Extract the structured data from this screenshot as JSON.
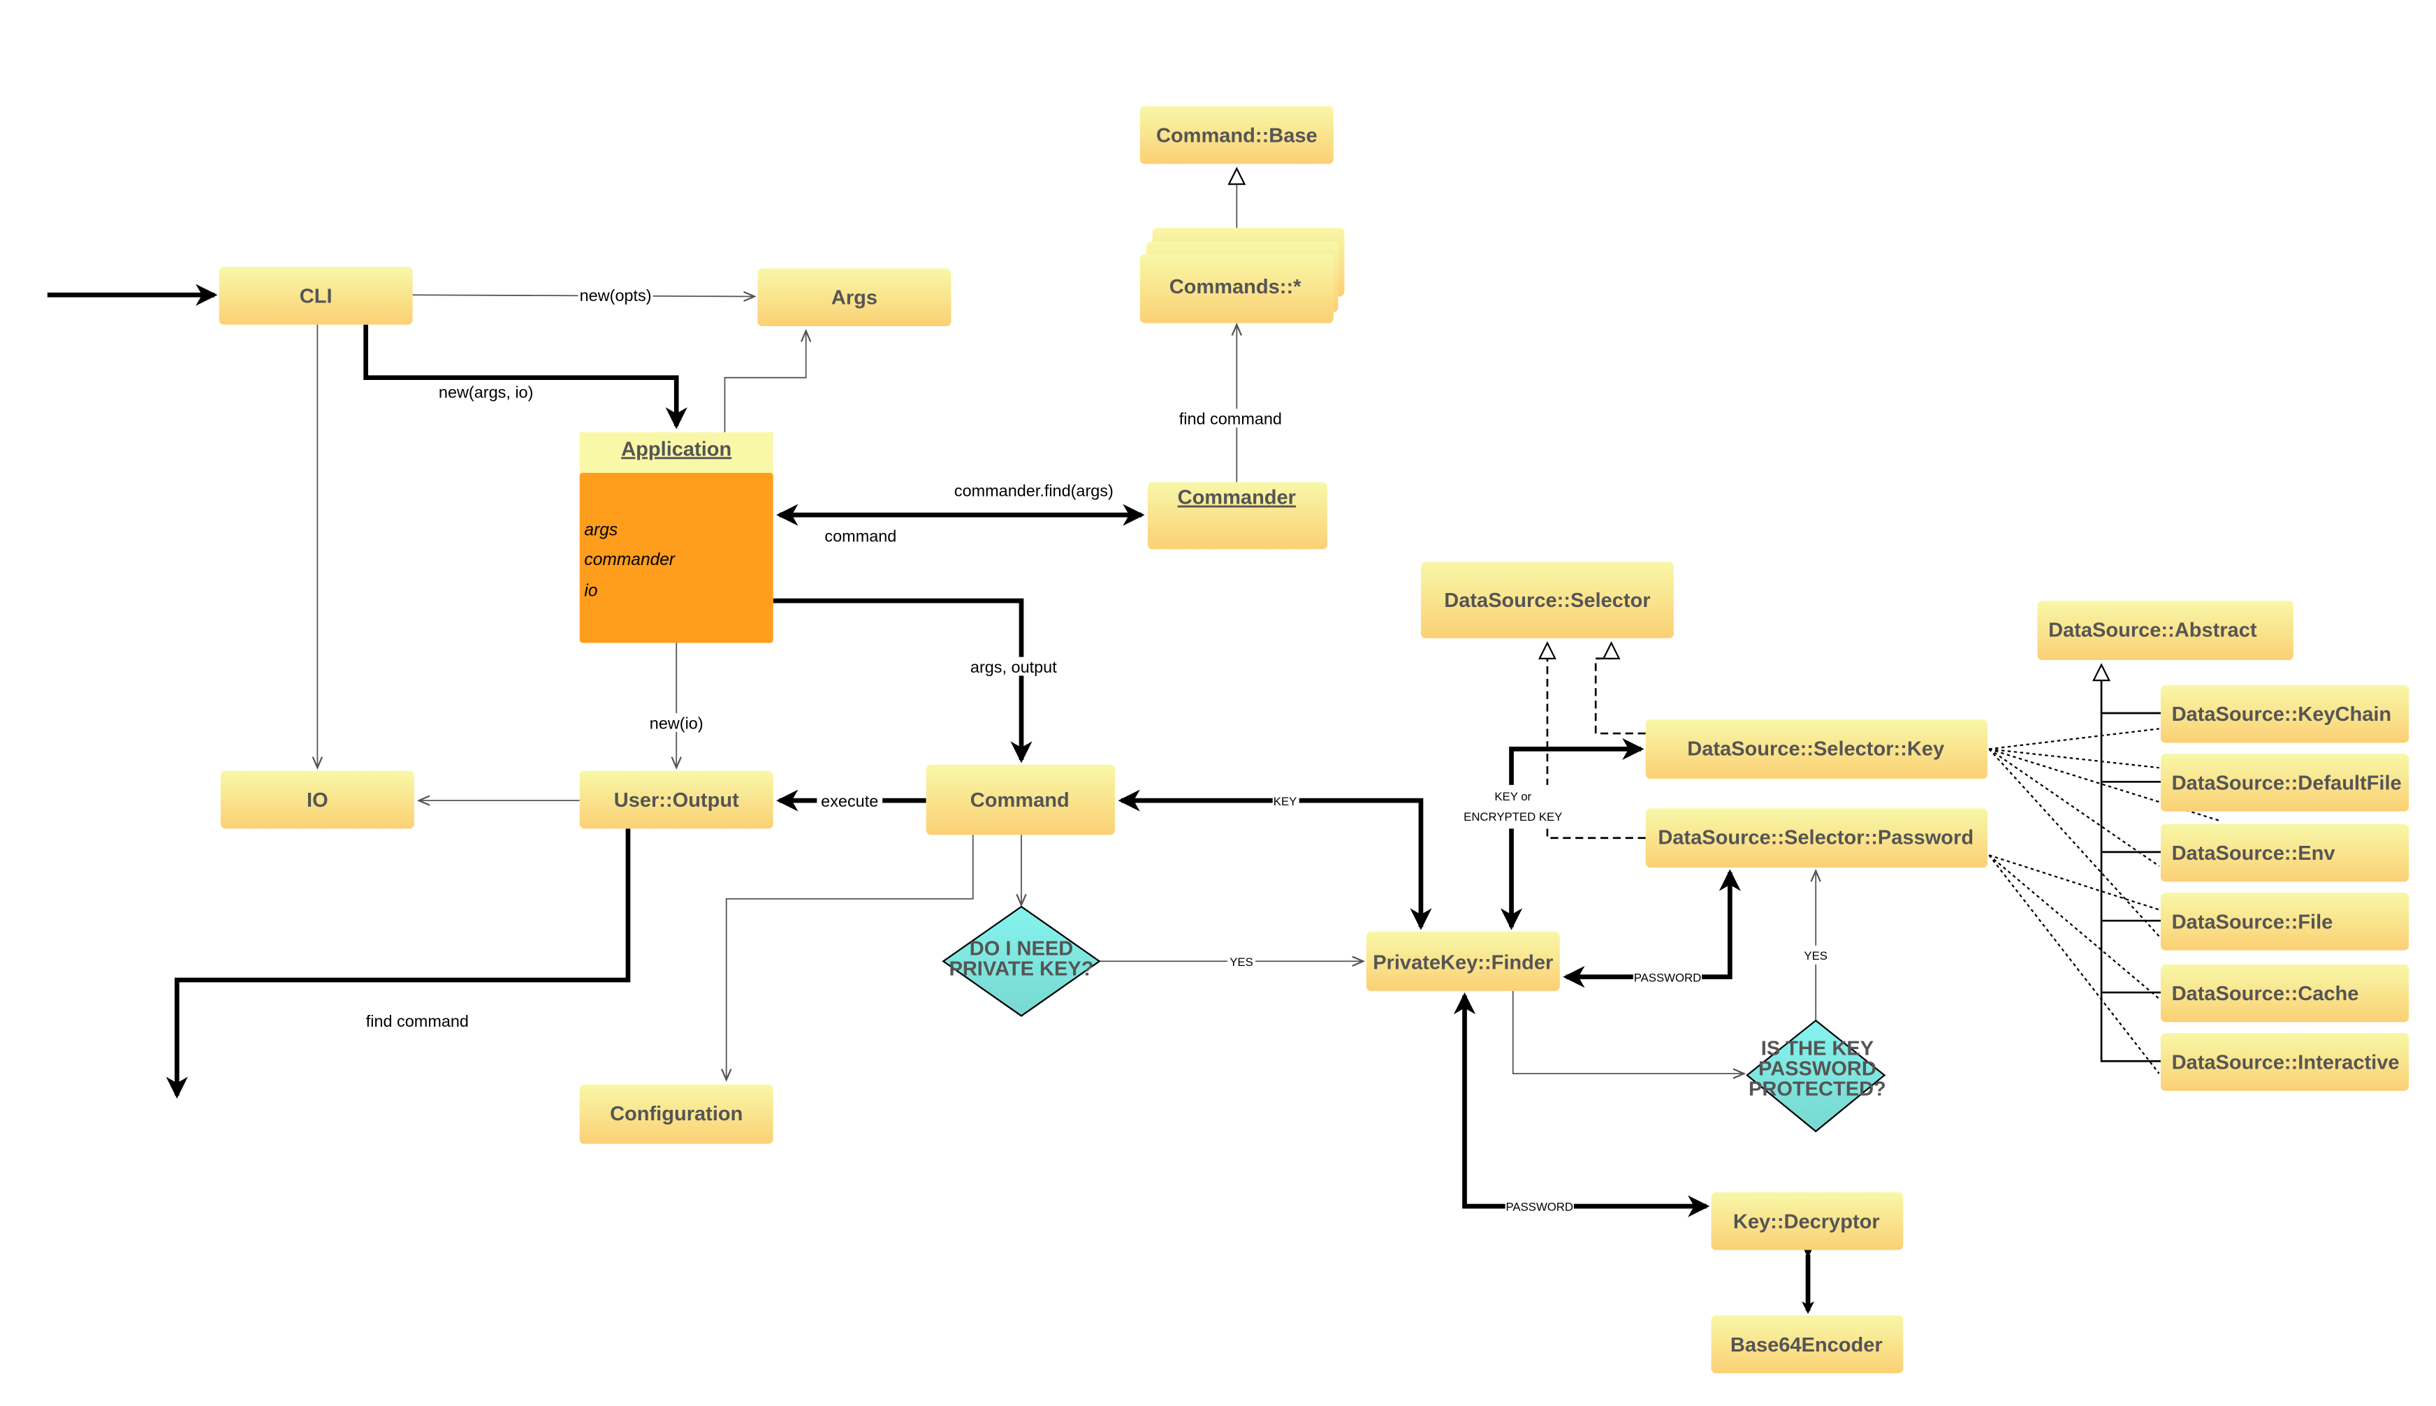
{
  "colors": {
    "box_top": "#f8f8a8",
    "box_bottom": "#fbd074",
    "application_body": "#ff9d1d",
    "diamond": "#7de8e0",
    "line": "#000000"
  },
  "nodes": {
    "cli": "CLI",
    "args": "Args",
    "command_base": "Command::Base",
    "commands": "Commands::*",
    "application": "Application",
    "application_fields": [
      "args",
      "commander",
      "io"
    ],
    "commander": "Commander",
    "io": "IO",
    "user_output": "User::Output",
    "command": "Command",
    "configuration": "Configuration",
    "do_i_need": [
      "DO I NEED",
      "PRIVATE KEY?"
    ],
    "privatekey_finder": "PrivateKey::Finder",
    "is_key_protected": [
      "IS THE KEY",
      "PASSWORD",
      "PROTECTED?"
    ],
    "ds_selector": "DataSource::Selector",
    "ds_selector_key": "DataSource::Selector::Key",
    "ds_selector_password": "DataSource::Selector::Password",
    "ds_abstract": "DataSource::Abstract",
    "ds_impls": [
      "DataSource::KeyChain",
      "DataSource::DefaultFile",
      "DataSource::Env",
      "DataSource::File",
      "DataSource::Cache",
      "DataSource::Interactive"
    ],
    "key_decryptor": "Key::Decryptor",
    "base64": "Base64Encoder"
  },
  "edges": {
    "new_opts": "new(opts)",
    "new_args_io": "new(args, io)",
    "commander_find": "commander.find(args)",
    "command": "command",
    "find_command_top": "find command",
    "args_output": "args, output",
    "new_io": "new(io)",
    "execute": "execute",
    "find_command_bottom": "find command",
    "yes1": "YES",
    "key": "KEY",
    "key_or": "KEY or",
    "encrypted_key": "ENCRYPTED KEY",
    "password1": "PASSWORD",
    "yes2": "YES",
    "password2": "PASSWORD"
  }
}
